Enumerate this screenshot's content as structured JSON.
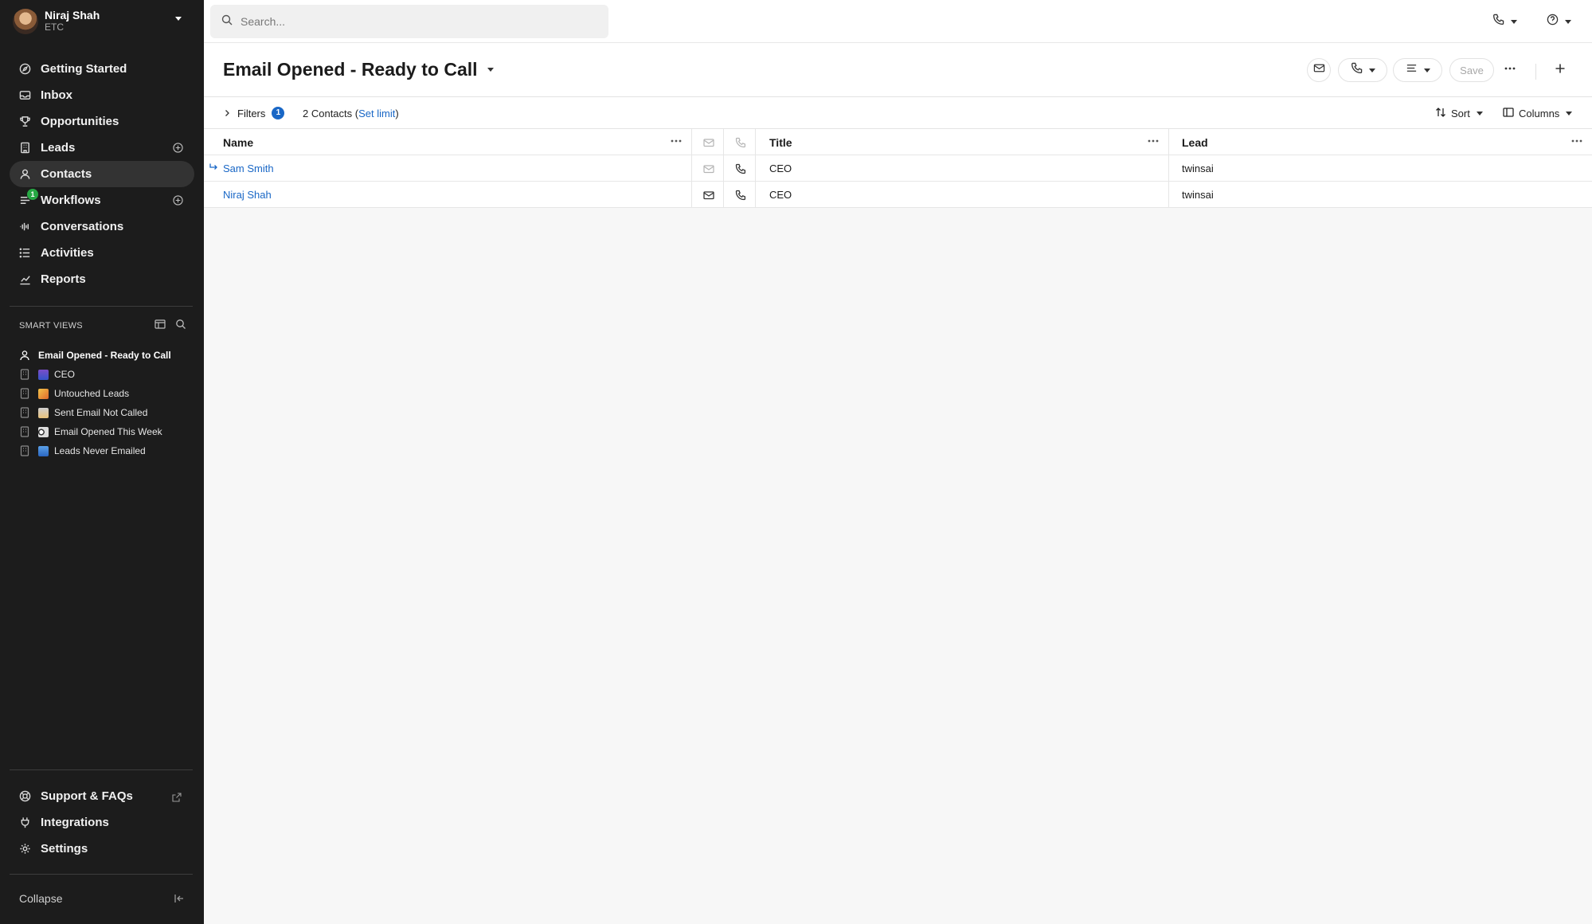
{
  "user": {
    "name": "Niraj Shah",
    "org": "ETC"
  },
  "nav": [
    {
      "label": "Getting Started",
      "icon": "compass-icon"
    },
    {
      "label": "Inbox",
      "icon": "inbox-icon"
    },
    {
      "label": "Opportunities",
      "icon": "trophy-icon"
    },
    {
      "label": "Leads",
      "icon": "building-icon"
    },
    {
      "label": "Contacts",
      "icon": "user-icon"
    },
    {
      "label": "Workflows",
      "icon": "workflow-icon",
      "badge": "1"
    },
    {
      "label": "Conversations",
      "icon": "waveform-icon"
    },
    {
      "label": "Activities",
      "icon": "list-icon"
    },
    {
      "label": "Reports",
      "icon": "chart-icon"
    }
  ],
  "smart_views": {
    "title": "SMART VIEWS",
    "items": [
      {
        "label": "Email Opened - Ready to Call"
      },
      {
        "label": "CEO"
      },
      {
        "label": "Untouched Leads"
      },
      {
        "label": "Sent Email Not Called"
      },
      {
        "label": "Email Opened This Week"
      },
      {
        "label": "Leads Never Emailed"
      }
    ]
  },
  "bottom_nav": [
    {
      "label": "Support & FAQs"
    },
    {
      "label": "Integrations"
    },
    {
      "label": "Settings"
    }
  ],
  "collapse_label": "Collapse",
  "search": {
    "placeholder": "Search..."
  },
  "page": {
    "title": "Email Opened - Ready to Call",
    "save_label": "Save"
  },
  "filterbar": {
    "filters_label": "Filters",
    "filters_count": "1",
    "count_text": "2 Contacts",
    "set_limit": "Set limit",
    "sort_label": "Sort",
    "columns_label": "Columns"
  },
  "table": {
    "columns": {
      "name": "Name",
      "title": "Title",
      "lead": "Lead"
    },
    "rows": [
      {
        "name": "Sam Smith",
        "title": "CEO",
        "lead": "twinsai"
      },
      {
        "name": "Niraj Shah",
        "title": "CEO",
        "lead": "twinsai"
      }
    ]
  },
  "colors": {
    "sidebar_bg": "#1c1c1c",
    "accent": "#1967c6",
    "badge_green": "#27a844"
  }
}
